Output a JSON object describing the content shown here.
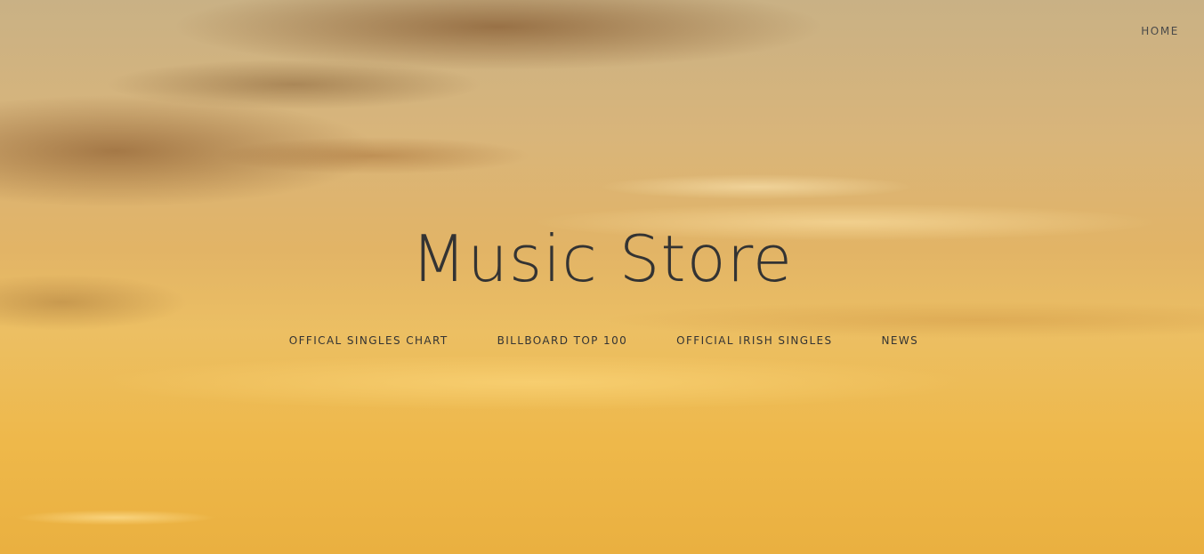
{
  "header": {
    "nav": {
      "home_label": "HOME"
    }
  },
  "hero": {
    "title": "Music Store",
    "menu": [
      {
        "label": "OFFICAL SINGLES CHART"
      },
      {
        "label": "BILLBOARD TOP 100"
      },
      {
        "label": "OFFICIAL IRISH SINGLES"
      },
      {
        "label": "NEWS"
      }
    ]
  },
  "colors": {
    "text": "#333333",
    "sky_top": "#c9b185",
    "sky_bottom": "#eab040"
  }
}
